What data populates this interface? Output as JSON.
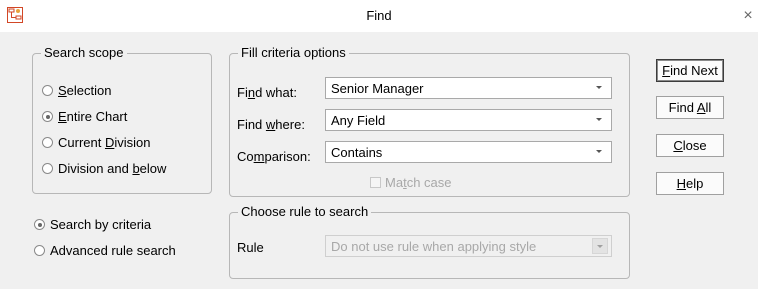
{
  "window": {
    "title": "Find",
    "close_glyph": "×",
    "icon": "app-chart-icon"
  },
  "search_scope": {
    "legend": "Search scope",
    "options": [
      {
        "label": "Selection",
        "accel": "S",
        "selected": false
      },
      {
        "label": "Entire Chart",
        "accel": "E",
        "selected": true
      },
      {
        "label": "Current Division",
        "accel": "D",
        "selected": false
      },
      {
        "label": "Division and below",
        "accel": "b",
        "selected": false
      }
    ]
  },
  "search_mode": {
    "options": [
      {
        "label": "Search by criteria",
        "selected": true
      },
      {
        "label": "Advanced rule search",
        "selected": false
      }
    ]
  },
  "fill_criteria": {
    "legend": "Fill criteria options",
    "find_what_label": "Find what:",
    "find_what_value": "Senior Manager",
    "find_where_label": "Find where:",
    "find_where_value": "Any Field",
    "comparison_label": "Comparison:",
    "comparison_value": "Contains",
    "match_case_label": "Match case",
    "match_case_checked": false
  },
  "rule": {
    "legend": "Choose rule to search",
    "label": "Rule",
    "value": "Do not use rule when applying style"
  },
  "buttons": {
    "find_next": "Find Next",
    "find_all": "Find All",
    "close": "Close",
    "help": "Help"
  }
}
